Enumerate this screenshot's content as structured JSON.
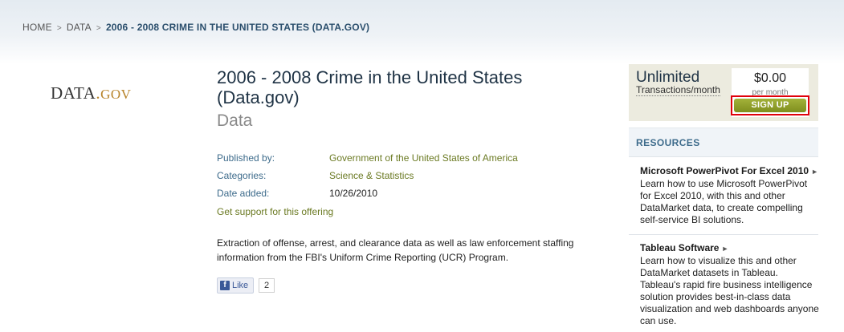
{
  "breadcrumb": {
    "items": [
      "HOME",
      "DATA"
    ],
    "separator": ">",
    "current": "2006 - 2008 CRIME IN THE UNITED STATES (DATA.GOV)"
  },
  "logo": {
    "part1": "DATA",
    "dot": ".",
    "part2": "GOV"
  },
  "dataset": {
    "title": "2006 - 2008 Crime in the United States (Data.gov)",
    "type": "Data",
    "published_by_label": "Published by:",
    "published_by": "Government of the United States of America",
    "categories_label": "Categories:",
    "categories": "Science & Statistics",
    "date_added_label": "Date added:",
    "date_added": "10/26/2010",
    "support_link": "Get support for this offering",
    "description": "Extraction of offense, arrest, and clearance data as well as law enforcement staffing information from the FBI's Uniform Crime Reporting (UCR) Program."
  },
  "social": {
    "like_label": "Like",
    "like_count": "2"
  },
  "pricing": {
    "plan_name": "Unlimited",
    "transactions_label": "Transactions/month",
    "price": "$0.00",
    "per_month": "per month",
    "signup_label": "SIGN UP"
  },
  "resources": {
    "heading": "RESOURCES",
    "items": [
      {
        "title": "Microsoft PowerPivot For Excel 2010",
        "text": "Learn how to use Microsoft PowerPivot for Excel 2010, with this and other DataMarket data, to create compelling self-service BI solutions."
      },
      {
        "title": "Tableau Software",
        "text": "Learn how to visualize this and other DataMarket datasets in Tableau. Tableau's rapid fire business intelligence solution provides best-in-class data visualization and web dashboards anyone can use."
      }
    ]
  },
  "colors": {
    "accent_green": "#8a9a26",
    "link_blue": "#3d6b8b",
    "highlight_red": "#e0000b"
  }
}
